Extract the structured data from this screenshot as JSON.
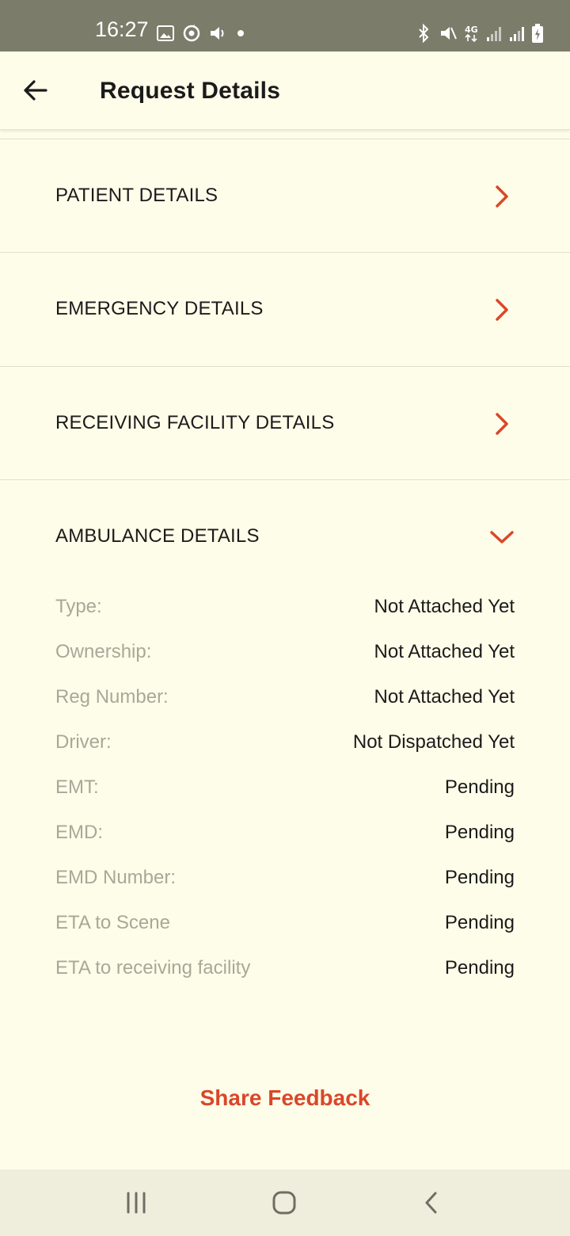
{
  "status_bar": {
    "time": "16:27",
    "left_icons": [
      "image-icon",
      "sync-icon",
      "volume-icon",
      "dot-icon"
    ],
    "right_icons": [
      "bluetooth-icon",
      "mute-icon",
      "4g-icon",
      "signal-icon",
      "signal-icon",
      "battery-charging-icon"
    ]
  },
  "app_bar": {
    "back_icon": "arrow-left-icon",
    "title": "Request Details"
  },
  "sections": [
    {
      "title": "PATIENT DETAILS",
      "state": "collapsed",
      "icon": "chevron-right-icon"
    },
    {
      "title": "EMERGENCY DETAILS",
      "state": "collapsed",
      "icon": "chevron-right-icon"
    },
    {
      "title": "RECEIVING FACILITY DETAILS",
      "state": "collapsed",
      "icon": "chevron-right-icon"
    },
    {
      "title": "AMBULANCE DETAILS",
      "state": "expanded",
      "icon": "chevron-down-icon"
    }
  ],
  "ambulance_details": [
    {
      "label": "Type:",
      "value": "Not Attached Yet"
    },
    {
      "label": "Ownership:",
      "value": "Not Attached Yet"
    },
    {
      "label": "Reg Number:",
      "value": "Not Attached Yet"
    },
    {
      "label": "Driver:",
      "value": "Not Dispatched Yet"
    },
    {
      "label": "EMT:",
      "value": "Pending"
    },
    {
      "label": "EMD:",
      "value": "Pending"
    },
    {
      "label": "EMD Number:",
      "value": "Pending"
    },
    {
      "label": "ETA to Scene",
      "value": "Pending"
    },
    {
      "label": "ETA to receiving facility",
      "value": "Pending"
    }
  ],
  "footer": {
    "feedback_label": "Share Feedback"
  },
  "nav_bar": {
    "icons": [
      "recent-apps-icon",
      "home-icon",
      "back-nav-icon"
    ]
  },
  "colors": {
    "background": "#fefde9",
    "accent": "#d9472a",
    "status_bar": "#7c7c6b",
    "label_gray": "#a8a89a",
    "nav_bar": "#efeddc"
  }
}
